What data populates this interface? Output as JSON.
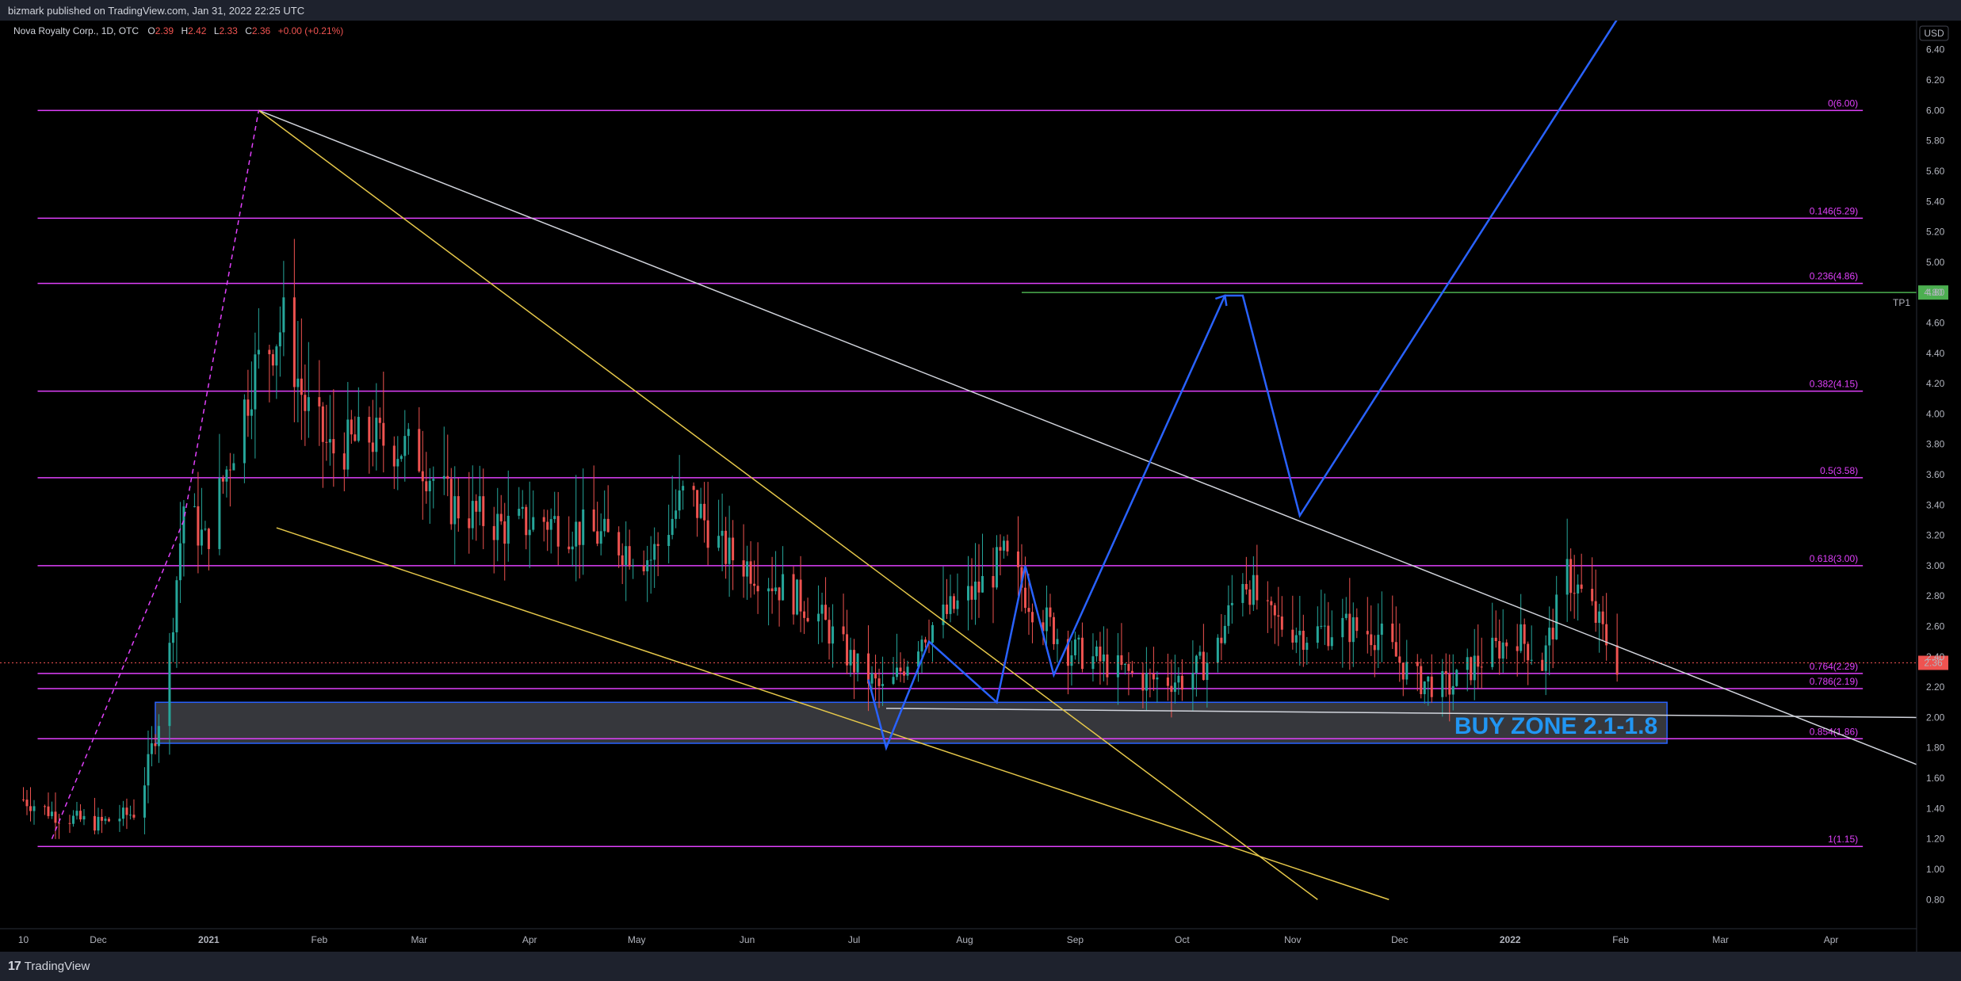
{
  "header": {
    "published": "bizmark published on TradingView.com, Jan 31, 2022 22:25 UTC"
  },
  "footer": {
    "brand": "TradingView",
    "logo_mark": "17"
  },
  "legend": {
    "symbol": "Nova Royalty Corp., 1D, OTC",
    "o_label": "O",
    "o": "2.39",
    "h_label": "H",
    "h": "2.42",
    "l_label": "L",
    "l": "2.33",
    "c_label": "C",
    "c": "2.36",
    "change": "+0.00 (+0.21%)"
  },
  "colors": {
    "background": "#000000",
    "chrome": "#1e222d",
    "up": "#26a69a",
    "down": "#ef5350",
    "fib": "#e040fb",
    "path": "#2962ff",
    "trend_white": "#d1d4dc",
    "trend_yellow": "#e6c84a",
    "zone_label": "#2196f3",
    "tp": "#4caf50"
  },
  "chart_data": {
    "type": "candlestick",
    "currency": "USD",
    "ylim": [
      0.65,
      6.55
    ],
    "y_ticks": [
      "0.80",
      "1.00",
      "1.20",
      "1.40",
      "1.60",
      "1.80",
      "2.00",
      "2.20",
      "2.40",
      "2.60",
      "2.80",
      "3.00",
      "3.20",
      "3.40",
      "3.60",
      "3.80",
      "4.00",
      "4.20",
      "4.40",
      "4.60",
      "4.80",
      "5.00",
      "5.20",
      "5.40",
      "5.60",
      "5.80",
      "6.00",
      "6.20",
      "6.40"
    ],
    "x_range": [
      "2020-11-07",
      "2022-04-25"
    ],
    "x_ticks": [
      {
        "date": "2020-11-10",
        "label": "10"
      },
      {
        "date": "2020-12-01",
        "label": "Dec"
      },
      {
        "date": "2021-01-01",
        "label": "2021"
      },
      {
        "date": "2021-02-01",
        "label": "Feb"
      },
      {
        "date": "2021-03-01",
        "label": "Mar"
      },
      {
        "date": "2021-04-01",
        "label": "Apr"
      },
      {
        "date": "2021-05-01",
        "label": "May"
      },
      {
        "date": "2021-06-01",
        "label": "Jun"
      },
      {
        "date": "2021-07-01",
        "label": "Jul"
      },
      {
        "date": "2021-08-01",
        "label": "Aug"
      },
      {
        "date": "2021-09-01",
        "label": "Sep"
      },
      {
        "date": "2021-10-01",
        "label": "Oct"
      },
      {
        "date": "2021-11-01",
        "label": "Nov"
      },
      {
        "date": "2021-12-01",
        "label": "Dec"
      },
      {
        "date": "2022-01-01",
        "label": "2022"
      },
      {
        "date": "2022-02-01",
        "label": "Feb"
      },
      {
        "date": "2022-03-01",
        "label": "Mar"
      },
      {
        "date": "2022-04-01",
        "label": "Apr"
      }
    ],
    "price_path": [
      [
        "2020-11-10",
        1.46
      ],
      [
        "2020-11-20",
        1.35
      ],
      [
        "2020-12-01",
        1.3
      ],
      [
        "2020-12-12",
        1.38
      ],
      [
        "2020-12-20",
        2.2
      ],
      [
        "2020-12-25",
        3.4
      ],
      [
        "2020-12-31",
        3.15
      ],
      [
        "2021-01-08",
        3.8
      ],
      [
        "2021-01-14",
        4.3
      ],
      [
        "2021-01-22",
        4.6
      ],
      [
        "2021-01-28",
        4.05
      ],
      [
        "2021-02-04",
        3.75
      ],
      [
        "2021-02-15",
        3.85
      ],
      [
        "2021-02-28",
        3.75
      ],
      [
        "2021-03-10",
        3.4
      ],
      [
        "2021-03-25",
        3.25
      ],
      [
        "2021-04-05",
        3.3
      ],
      [
        "2021-04-20",
        3.2
      ],
      [
        "2021-05-05",
        3.05
      ],
      [
        "2021-05-15",
        3.5
      ],
      [
        "2021-05-25",
        3.1
      ],
      [
        "2021-06-05",
        2.95
      ],
      [
        "2021-06-20",
        2.7
      ],
      [
        "2021-07-01",
        2.35
      ],
      [
        "2021-07-10",
        2.15
      ],
      [
        "2021-07-20",
        2.55
      ],
      [
        "2021-07-28",
        2.7
      ],
      [
        "2021-08-05",
        2.85
      ],
      [
        "2021-08-12",
        3.05
      ],
      [
        "2021-08-20",
        2.75
      ],
      [
        "2021-08-30",
        2.45
      ],
      [
        "2021-09-10",
        2.35
      ],
      [
        "2021-09-20",
        2.25
      ],
      [
        "2021-10-01",
        2.25
      ],
      [
        "2021-10-10",
        2.4
      ],
      [
        "2021-10-18",
        2.95
      ],
      [
        "2021-10-25",
        2.65
      ],
      [
        "2021-11-05",
        2.55
      ],
      [
        "2021-11-15",
        2.6
      ],
      [
        "2021-11-25",
        2.55
      ],
      [
        "2021-12-05",
        2.25
      ],
      [
        "2021-12-15",
        2.2
      ],
      [
        "2021-12-22",
        2.35
      ],
      [
        "2022-01-03",
        2.55
      ],
      [
        "2022-01-10",
        2.35
      ],
      [
        "2022-01-17",
        2.95
      ],
      [
        "2022-01-24",
        2.7
      ],
      [
        "2022-01-31",
        2.36
      ]
    ],
    "fib_levels": [
      {
        "label": "0(6.00)",
        "value": 6.0
      },
      {
        "label": "0.146(5.29)",
        "value": 5.29
      },
      {
        "label": "0.236(4.86)",
        "value": 4.86
      },
      {
        "label": "0.382(4.15)",
        "value": 4.15
      },
      {
        "label": "0.5(3.58)",
        "value": 3.58
      },
      {
        "label": "0.618(3.00)",
        "value": 3.0
      },
      {
        "label": "0.764(2.29)",
        "value": 2.29
      },
      {
        "label": "0.786(2.19)",
        "value": 2.19
      },
      {
        "label": "0.854(1.86)",
        "value": 1.86
      },
      {
        "label": "1(1.15)",
        "value": 1.15
      }
    ],
    "fib_start": "2020-11-14",
    "fib_end": "2022-01-31",
    "buy_zone": {
      "label": "BUY ZONE 2.1-1.8",
      "x0": "2020-12-17",
      "x1": "2022-02-14",
      "y0": 1.83,
      "y1": 2.1
    },
    "target": {
      "label": "TP1",
      "value": 4.8,
      "value_text": "4.80",
      "from": "2021-08-17"
    },
    "last_price": {
      "value": 2.36,
      "value_text": "2.36"
    },
    "trendlines_white": [
      [
        [
          "2021-01-15",
          6.0
        ],
        [
          "2022-04-25",
          1.69
        ]
      ],
      [
        [
          "2021-07-10",
          2.06
        ],
        [
          "2022-04-25",
          2.0
        ]
      ]
    ],
    "trendlines_yellow": [
      [
        [
          "2021-01-15",
          6.0
        ],
        [
          "2021-11-08",
          0.8
        ]
      ],
      [
        [
          "2021-01-20",
          3.25
        ],
        [
          "2021-11-28",
          0.8
        ]
      ],
      [
        [
          "2020-11-18",
          1.2
        ],
        [
          "2020-12-25",
          3.3
        ],
        [
          "2021-01-15",
          6.0
        ]
      ]
    ],
    "projection_path": [
      [
        "2021-07-05",
        2.25
      ],
      [
        "2021-07-10",
        1.8
      ],
      [
        "2021-07-22",
        2.5
      ],
      [
        "2021-08-10",
        2.1
      ],
      [
        "2021-08-18",
        3.0
      ],
      [
        "2021-08-26",
        2.28
      ],
      [
        "2021-10-13",
        4.78
      ],
      [
        "2021-10-18",
        4.78
      ],
      [
        "2021-11-03",
        3.33
      ],
      [
        "2022-01-31",
        6.6
      ]
    ]
  }
}
